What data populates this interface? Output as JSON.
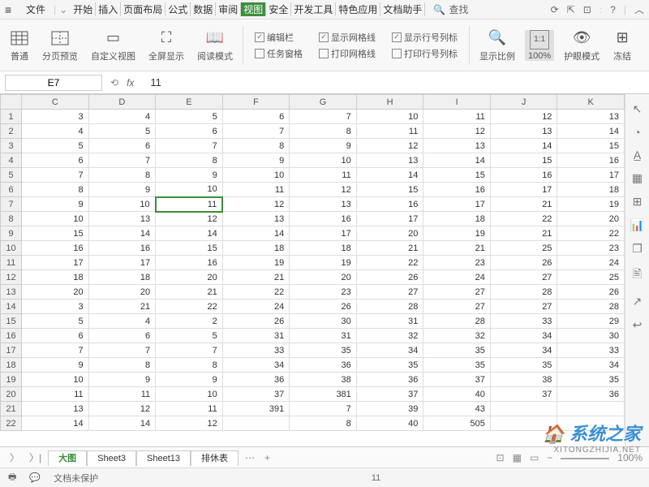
{
  "topbar": {
    "file_label": "文件",
    "tabs": [
      "开始",
      "插入",
      "页面布局",
      "公式",
      "数据",
      "审阅",
      "视图",
      "安全",
      "开发工具",
      "特色应用",
      "文档助手"
    ],
    "active_tab": 6,
    "search_label": "查找"
  },
  "ribbon": {
    "views": [
      "普通",
      "分页预览",
      "自定义视图",
      "全屏显示",
      "阅读模式"
    ],
    "checks": {
      "edit_bar": {
        "label": "编辑栏",
        "checked": true
      },
      "task_pane": {
        "label": "任务窗格",
        "checked": false
      },
      "grid_show": {
        "label": "显示网格线",
        "checked": true
      },
      "grid_print": {
        "label": "打印网格线",
        "checked": false
      },
      "rowcol_show": {
        "label": "显示行号列标",
        "checked": true
      },
      "rowcol_print": {
        "label": "打印行号列标",
        "checked": false
      }
    },
    "zoom_lbl": "显示比例",
    "pct_lbl": "100%",
    "eye_lbl": "护眼模式",
    "freeze_lbl": "冻结"
  },
  "formula_bar": {
    "cell_ref": "E7",
    "value": "11"
  },
  "grid": {
    "cols": [
      "C",
      "D",
      "E",
      "F",
      "G",
      "H",
      "I",
      "J",
      "K"
    ],
    "rows": [
      1,
      2,
      3,
      4,
      5,
      6,
      7,
      8,
      9,
      10,
      11,
      12,
      13,
      14,
      15,
      16,
      17,
      18,
      19,
      20,
      21,
      22
    ],
    "data": [
      [
        3,
        4,
        5,
        6,
        7,
        10,
        11,
        12,
        13
      ],
      [
        4,
        5,
        6,
        7,
        8,
        11,
        12,
        13,
        14
      ],
      [
        5,
        6,
        7,
        8,
        9,
        12,
        13,
        14,
        15
      ],
      [
        6,
        7,
        8,
        9,
        10,
        13,
        14,
        15,
        16
      ],
      [
        7,
        8,
        9,
        10,
        11,
        14,
        15,
        16,
        17
      ],
      [
        8,
        9,
        10,
        11,
        12,
        15,
        16,
        17,
        18
      ],
      [
        9,
        10,
        11,
        12,
        13,
        16,
        17,
        21,
        19
      ],
      [
        10,
        13,
        12,
        13,
        16,
        17,
        18,
        22,
        20
      ],
      [
        15,
        14,
        14,
        14,
        17,
        20,
        19,
        21,
        22
      ],
      [
        16,
        16,
        15,
        18,
        18,
        21,
        21,
        25,
        23
      ],
      [
        17,
        17,
        16,
        19,
        19,
        22,
        23,
        26,
        24
      ],
      [
        18,
        18,
        20,
        21,
        20,
        26,
        24,
        27,
        25
      ],
      [
        20,
        20,
        21,
        22,
        23,
        27,
        27,
        28,
        26
      ],
      [
        3,
        21,
        22,
        24,
        26,
        28,
        27,
        27,
        28
      ],
      [
        5,
        4,
        2,
        26,
        30,
        31,
        28,
        33,
        29
      ],
      [
        6,
        6,
        5,
        31,
        31,
        32,
        32,
        34,
        30
      ],
      [
        7,
        7,
        7,
        33,
        35,
        34,
        35,
        34,
        33
      ],
      [
        9,
        8,
        8,
        34,
        36,
        35,
        35,
        35,
        34
      ],
      [
        10,
        9,
        9,
        36,
        38,
        36,
        37,
        38,
        35
      ],
      [
        11,
        11,
        10,
        37,
        381,
        37,
        40,
        37,
        36
      ],
      [
        13,
        12,
        11,
        391,
        7,
        39,
        43,
        "",
        ""
      ],
      [
        14,
        14,
        12,
        "",
        8,
        40,
        505,
        "",
        ""
      ]
    ],
    "selected": {
      "r": 7,
      "c": "E"
    }
  },
  "sheets": {
    "tabs": [
      "大图",
      "Sheet3",
      "Sheet13",
      "排休表"
    ],
    "active": 0
  },
  "status": {
    "protect": "文档未保护",
    "center": "11",
    "zoom": "100%"
  },
  "watermark": {
    "brand": "系统之家",
    "url": "XITONGZHIJIA.NET"
  }
}
